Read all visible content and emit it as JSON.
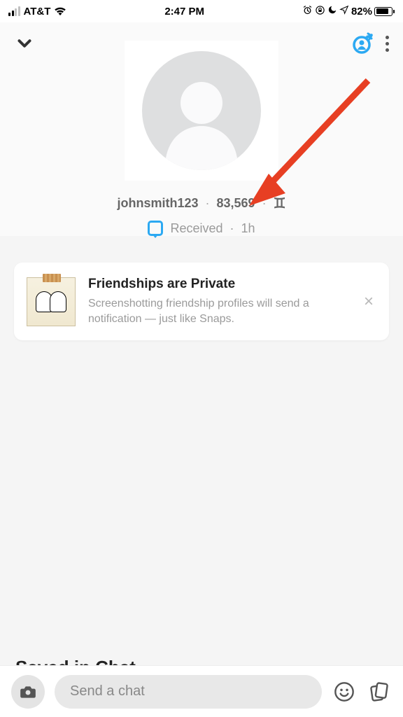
{
  "status_bar": {
    "carrier": "AT&T",
    "time": "2:47 PM",
    "battery_percent": "82%",
    "battery_fill_percent": 82
  },
  "profile": {
    "username": "johnsmith123",
    "score": "83,569",
    "zodiac_symbol": "♊︎",
    "status_label": "Received",
    "status_time": "1h"
  },
  "notice": {
    "title": "Friendships are Private",
    "body": "Screenshotting friendship profiles will send a notification — just like Snaps."
  },
  "cut_heading": "Saved in Chat",
  "bottom": {
    "chat_placeholder": "Send a chat"
  },
  "colors": {
    "accent_blue": "#2ca9f2",
    "arrow_red": "#e73f23"
  }
}
